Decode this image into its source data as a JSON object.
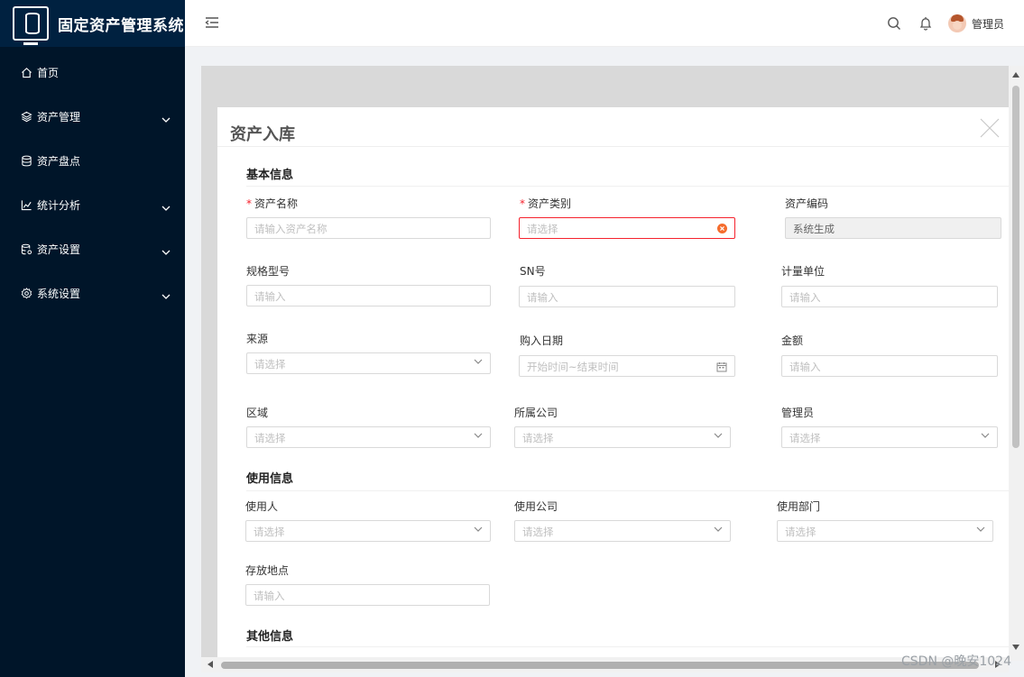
{
  "app": {
    "title": "固定资产管理系统"
  },
  "sidebar": {
    "items": [
      {
        "label": "首页",
        "icon": "home-icon",
        "expandable": false
      },
      {
        "label": "资产管理",
        "icon": "layers-icon",
        "expandable": true
      },
      {
        "label": "资产盘点",
        "icon": "database-icon",
        "expandable": false
      },
      {
        "label": "统计分析",
        "icon": "line-chart-icon",
        "expandable": true
      },
      {
        "label": "资产设置",
        "icon": "database-settings-icon",
        "expandable": true
      },
      {
        "label": "系统设置",
        "icon": "gear-icon",
        "expandable": true
      }
    ]
  },
  "header": {
    "user_name": "管理员"
  },
  "dialog": {
    "title": "资产入库",
    "sections": {
      "basic": "基本信息",
      "usage": "使用信息",
      "other": "其他信息"
    },
    "fields": {
      "asset_name": {
        "label": "资产名称",
        "placeholder": "请输入资产名称",
        "required": true
      },
      "asset_category": {
        "label": "资产类别",
        "placeholder": "请选择",
        "required": true
      },
      "asset_code": {
        "label": "资产编码",
        "value": "系统生成"
      },
      "spec_model": {
        "label": "规格型号",
        "placeholder": "请输入"
      },
      "sn": {
        "label": "SN号",
        "placeholder": "请输入"
      },
      "unit": {
        "label": "计量单位",
        "placeholder": "请输入"
      },
      "source": {
        "label": "来源",
        "placeholder": "请选择"
      },
      "purchase_date": {
        "label": "购入日期",
        "placeholder": "开始时间~结束时间"
      },
      "amount": {
        "label": "金额",
        "placeholder": "请输入"
      },
      "region": {
        "label": "区域",
        "placeholder": "请选择"
      },
      "company": {
        "label": "所属公司",
        "placeholder": "请选择"
      },
      "manager": {
        "label": "管理员",
        "placeholder": "请选择"
      },
      "user": {
        "label": "使用人",
        "placeholder": "请选择"
      },
      "user_company": {
        "label": "使用公司",
        "placeholder": "请选择"
      },
      "user_dept": {
        "label": "使用部门",
        "placeholder": "请选择"
      },
      "location": {
        "label": "存放地点",
        "placeholder": "请输入"
      }
    }
  },
  "watermark": "CSDN @晚安1024",
  "colors": {
    "sidebar_bg": "#001529",
    "required": "#f5222d",
    "clear_icon": "#f56c2d"
  }
}
